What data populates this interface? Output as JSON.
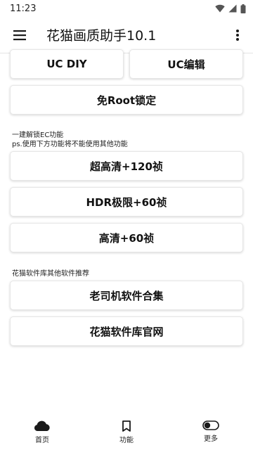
{
  "status_bar": {
    "time": "11:23"
  },
  "app_bar": {
    "title": "花猫画质助手10.1"
  },
  "top_buttons": {
    "uc_diy": "UC DIY",
    "uc_edit": "UC编辑"
  },
  "root_lock_button": "免Root锁定",
  "section1": {
    "title": "一建解锁EC功能",
    "note": "ps.使用下方功能将不能使用其他功能"
  },
  "fps_buttons": [
    "超高清+120祯",
    "HDR极限+60祯",
    "高清+60祯"
  ],
  "section2": {
    "title": "花猫软件库其他软件推荐"
  },
  "recommend_buttons": [
    "老司机软件合集",
    "花猫软件库官网"
  ],
  "bottom_nav": {
    "items": [
      {
        "label": "首页",
        "icon": "cloud-icon"
      },
      {
        "label": "功能",
        "icon": "bookmark-icon"
      },
      {
        "label": "更多",
        "icon": "toggle-icon"
      }
    ]
  },
  "colors": {
    "background": "#ffffff",
    "text": "#111111",
    "icon": "#1a1a1a"
  }
}
